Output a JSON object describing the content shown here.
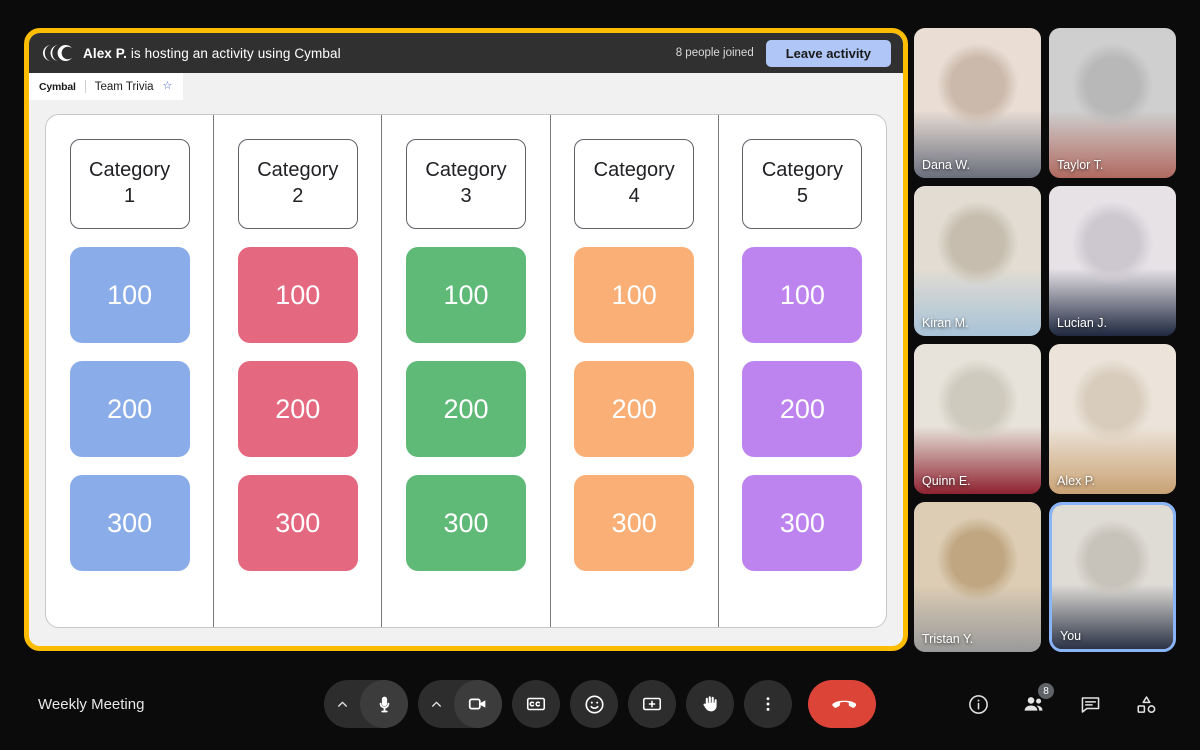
{
  "activity": {
    "logo_name": "cymbal-logo",
    "host_name": "Alex P.",
    "host_text_rest": " is hosting an activity using Cymbal",
    "joined_count_label": "8 people joined",
    "leave_button_label": "Leave activity",
    "tab": {
      "brand": "Cymbal",
      "title": "Team Trivia",
      "star_icon": "star-icon",
      "star_glyph": "☆"
    },
    "frame_color": "#FCBD00"
  },
  "board": {
    "columns": [
      {
        "category": "Category 1",
        "category_line1": "Category",
        "category_line2": "1",
        "color": "#8AACE8",
        "tiles": [
          "100",
          "200",
          "300"
        ]
      },
      {
        "category": "Category 2",
        "category_line1": "Category",
        "category_line2": "2",
        "color": "#E4687F",
        "tiles": [
          "100",
          "200",
          "300"
        ]
      },
      {
        "category": "Category 3",
        "category_line1": "Category",
        "category_line2": "3",
        "color": "#5FB977",
        "tiles": [
          "100",
          "200",
          "300"
        ]
      },
      {
        "category": "Category 4",
        "category_line1": "Category",
        "category_line2": "4",
        "color": "#F9AF76",
        "tiles": [
          "100",
          "200",
          "300"
        ]
      },
      {
        "category": "Category 5",
        "category_line1": "Category",
        "category_line2": "5",
        "color": "#BD84F0",
        "tiles": [
          "100",
          "200",
          "300"
        ]
      }
    ]
  },
  "participants": [
    {
      "name": "Dana W.",
      "self": false
    },
    {
      "name": "Taylor T.",
      "self": false
    },
    {
      "name": "Kiran M.",
      "self": false
    },
    {
      "name": "Lucian J.",
      "self": false
    },
    {
      "name": "Quinn E.",
      "self": false
    },
    {
      "name": "Alex P.",
      "self": false
    },
    {
      "name": "Tristan Y.",
      "self": false
    },
    {
      "name": "You",
      "self": true
    }
  ],
  "bottom_bar": {
    "meeting_name": "Weekly Meeting",
    "controls": [
      {
        "name": "microphone-button",
        "icon": "microphone-icon"
      },
      {
        "name": "camera-button",
        "icon": "camera-icon"
      },
      {
        "name": "captions-button",
        "icon": "closed-captions-icon"
      },
      {
        "name": "reactions-button",
        "icon": "emoji-icon"
      },
      {
        "name": "present-button",
        "icon": "present-screen-icon"
      },
      {
        "name": "raise-hand-button",
        "icon": "raised-hand-icon"
      },
      {
        "name": "more-options-button",
        "icon": "three-dots-icon"
      },
      {
        "name": "end-call-button",
        "icon": "end-call-icon"
      }
    ],
    "right_controls": [
      {
        "name": "meeting-details-button",
        "icon": "info-icon",
        "badge": ""
      },
      {
        "name": "participants-button",
        "icon": "people-icon",
        "badge": "8"
      },
      {
        "name": "chat-button",
        "icon": "chat-icon",
        "badge": ""
      },
      {
        "name": "activities-button",
        "icon": "activities-shapes-icon",
        "badge": ""
      }
    ],
    "end_call_color": "#DB4437"
  }
}
